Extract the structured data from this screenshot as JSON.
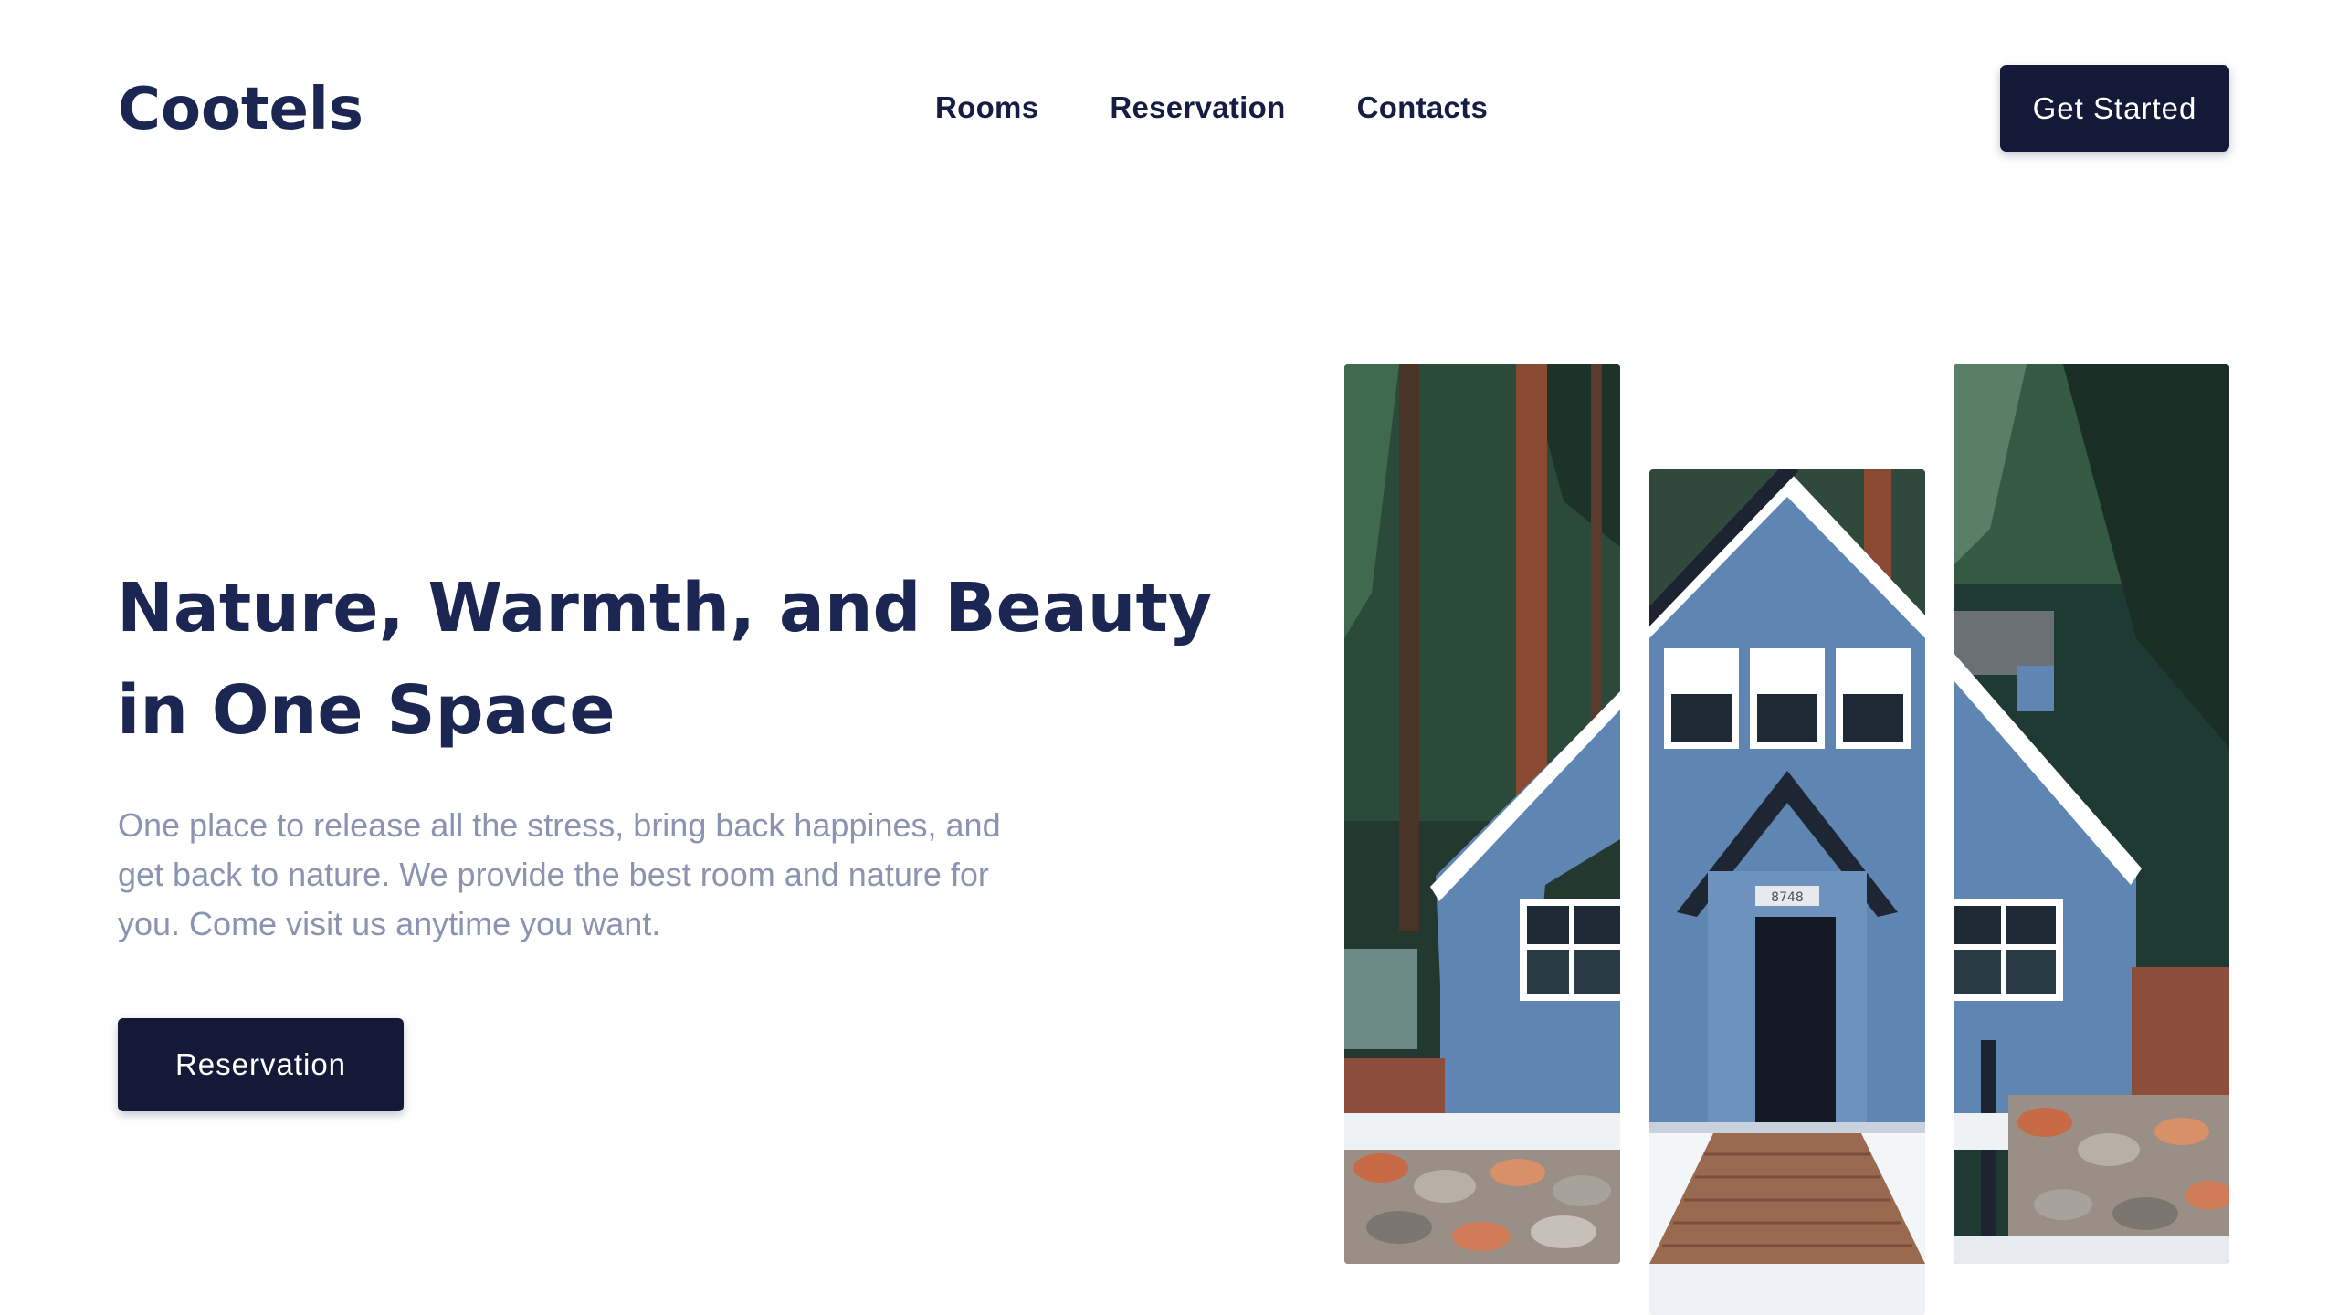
{
  "brand": {
    "name": "Cootels"
  },
  "nav": {
    "items": [
      {
        "label": "Rooms"
      },
      {
        "label": "Reservation"
      },
      {
        "label": "Contacts"
      }
    ],
    "cta_label": "Get Started"
  },
  "hero": {
    "title": "Nature, Warmth, and Beauty in One Space",
    "description": "One place to release all the stress, bring back happines, and get back to nature. We provide the best room and nature for you. Come visit us anytime you want.",
    "button_label": "Reservation",
    "images": [
      {
        "alt": "cabin-left-slice"
      },
      {
        "alt": "cabin-center-slice"
      },
      {
        "alt": "cabin-right-slice"
      }
    ],
    "house_number": "8748"
  },
  "colors": {
    "brand_navy": "#1c2653",
    "button_bg": "#131936",
    "muted_text": "#8a94b0",
    "cabin_blue": "#5f86b3"
  }
}
